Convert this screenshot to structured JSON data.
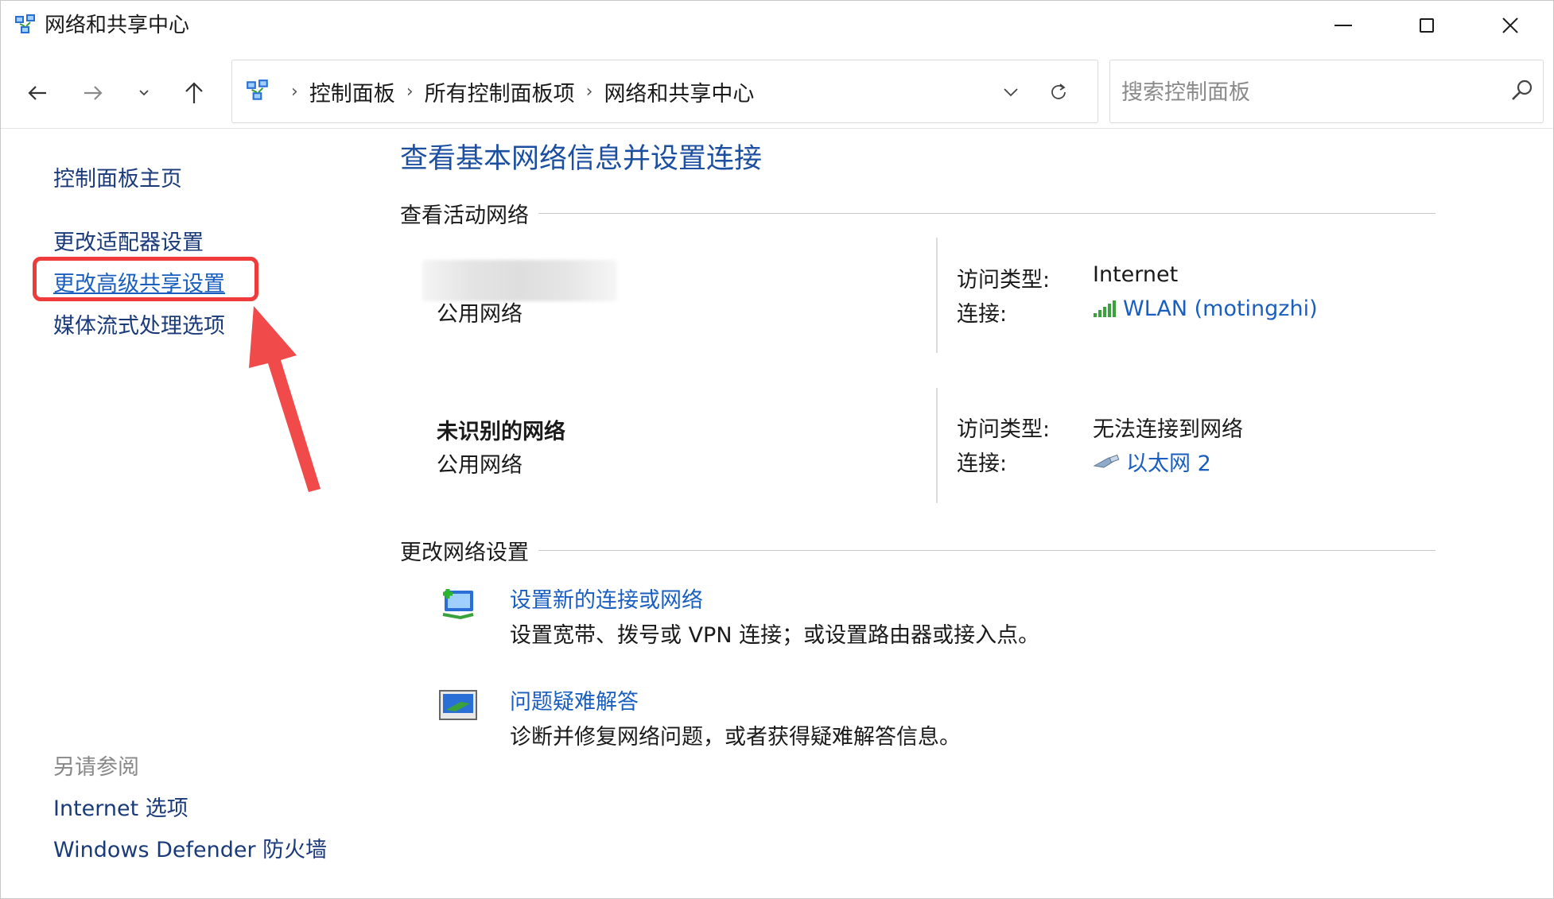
{
  "window": {
    "title": "网络和共享中心",
    "icon": "network-center-icon"
  },
  "navigation": {
    "breadcrumbs": [
      "控制面板",
      "所有控制面板项",
      "网络和共享中心"
    ],
    "search_placeholder": "搜索控制面板"
  },
  "sidebar": {
    "home": "控制面板主页",
    "adapter": "更改适配器设置",
    "sharing": "更改高级共享设置",
    "media": "媒体流式处理选项",
    "see_also_label": "另请参阅",
    "see_also": [
      "Internet 选项",
      "Windows Defender 防火墙"
    ]
  },
  "main": {
    "title": "查看基本网络信息并设置连接",
    "active_header": "查看活动网络",
    "networks": [
      {
        "name": "",
        "type": "公用网络",
        "access_label": "访问类型:",
        "access_value": "Internet",
        "conn_label": "连接:",
        "conn_value": "WLAN (motingzhi)",
        "conn_icon": "wifi-signal-icon"
      },
      {
        "name": "未识别的网络",
        "type": "公用网络",
        "access_label": "访问类型:",
        "access_value": "无法连接到网络",
        "conn_label": "连接:",
        "conn_value": "以太网 2",
        "conn_icon": "ethernet-icon"
      }
    ],
    "change_header": "更改网络设置",
    "tasks": [
      {
        "title": "设置新的连接或网络",
        "desc": "设置宽带、拨号或 VPN 连接；或设置路由器或接入点。",
        "icon": "new-connection-icon"
      },
      {
        "title": "问题疑难解答",
        "desc": "诊断并修复网络问题，或者获得疑难解答信息。",
        "icon": "troubleshoot-icon"
      }
    ]
  },
  "colors": {
    "link": "#1a5fbf",
    "title": "#1d4fa0",
    "highlight": "#ef3b3b"
  }
}
